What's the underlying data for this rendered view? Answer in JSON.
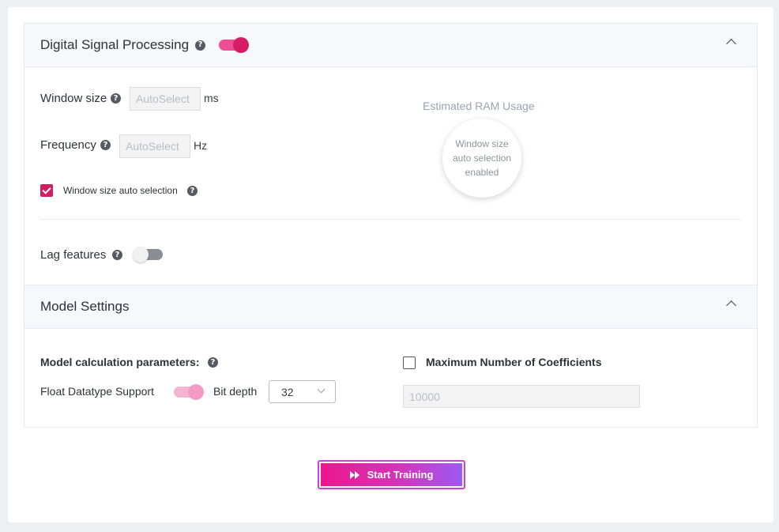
{
  "dsp": {
    "title": "Digital Signal Processing",
    "enabled": true,
    "window_size_label": "Window size",
    "window_size_placeholder": "AutoSelect",
    "window_size_unit": "ms",
    "frequency_label": "Frequency",
    "frequency_placeholder": "AutoSelect",
    "frequency_unit": "Hz",
    "auto_selection_label": "Window size auto selection",
    "auto_selection_checked": true,
    "ram_title": "Estimated RAM Usage",
    "ram_message": "Window size auto selection enabled",
    "lag_features_label": "Lag features",
    "lag_features_enabled": false
  },
  "model": {
    "title": "Model Settings",
    "params_label": "Model calculation parameters:",
    "float_label": "Float Datatype Support",
    "float_enabled": true,
    "bit_depth_label": "Bit depth",
    "bit_depth_value": "32",
    "max_coeff_label": "Maximum Number of Coefficients",
    "max_coeff_checked": false,
    "max_coeff_value": "10000"
  },
  "actions": {
    "start_label": "Start Training"
  },
  "colors": {
    "accent": "#d81b66",
    "gradient_start": "#ec178e",
    "gradient_end": "#9c5af2"
  }
}
